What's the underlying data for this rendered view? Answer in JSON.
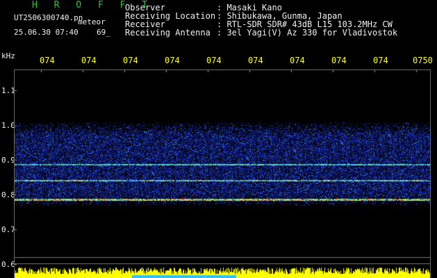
{
  "header": {
    "title": "H R O F F T",
    "file_name": "UT2506300740.pn",
    "meteor_label": "meteor",
    "datetime": "25.06.30 07:40",
    "count": "69_"
  },
  "info": [
    {
      "key": "Observer",
      "value": ": Masaki Kano"
    },
    {
      "key": "Receiving Location",
      "value": ": Shibukawa, Gunma, Japan"
    },
    {
      "key": "Receiver",
      "value": ": RTL-SDR SDR# 43dB L15 103.2MHz CW"
    },
    {
      "key": "Receiving Antenna",
      "value": ": 3el Yagi(V) Az 330 for Vladivostok"
    }
  ],
  "axis": {
    "unit": "kHz",
    "time_ticks": [
      "074",
      "074",
      "074",
      "074",
      "074",
      "074",
      "074",
      "074",
      "074",
      "0750"
    ],
    "freq_ticks": [
      "1.1",
      "1.0",
      "0.9",
      "0.8",
      "0.7",
      "0.6"
    ]
  },
  "colors": {
    "background": "#000000",
    "time_tick": "#ffff20",
    "title": "#1ed21e",
    "text": "#f0f0f0",
    "noise_band": "#1c2cb4",
    "signal_line": "#50dcf0",
    "bottom_activity": "#ffff00"
  }
}
